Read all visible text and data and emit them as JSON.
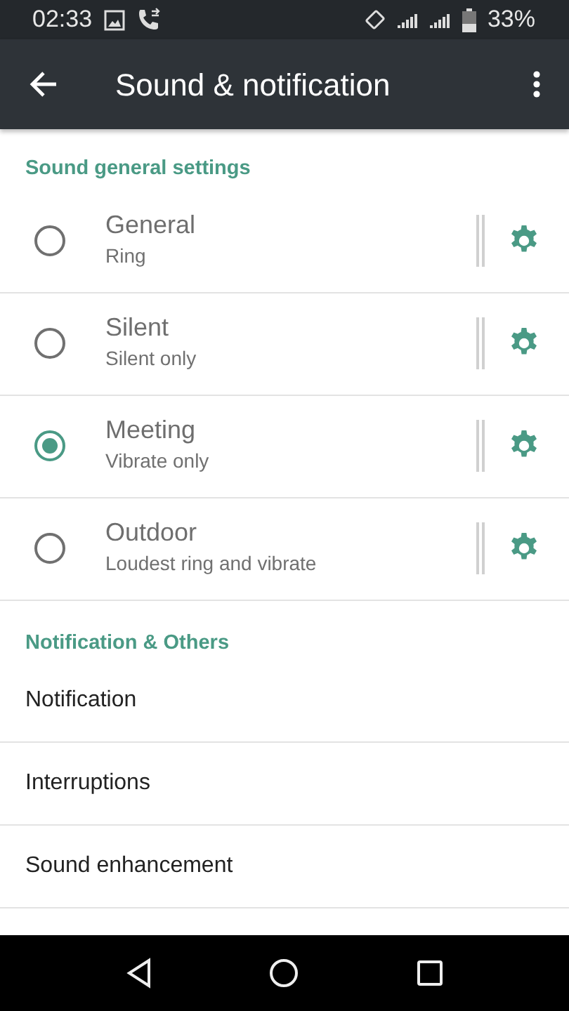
{
  "status_bar": {
    "time": "02:33",
    "battery": "33%"
  },
  "app_bar": {
    "title": "Sound & notification"
  },
  "sections": [
    {
      "header": "Sound general settings",
      "kind": "profiles",
      "items": [
        {
          "title": "General",
          "subtitle": "Ring",
          "selected": false
        },
        {
          "title": "Silent",
          "subtitle": "Silent only",
          "selected": false
        },
        {
          "title": "Meeting",
          "subtitle": "Vibrate only",
          "selected": true
        },
        {
          "title": "Outdoor",
          "subtitle": "Loudest ring and vibrate",
          "selected": false
        }
      ]
    },
    {
      "header": "Notification & Others",
      "kind": "links",
      "items": [
        {
          "title": "Notification"
        },
        {
          "title": "Interruptions"
        },
        {
          "title": "Sound enhancement"
        }
      ]
    }
  ]
}
